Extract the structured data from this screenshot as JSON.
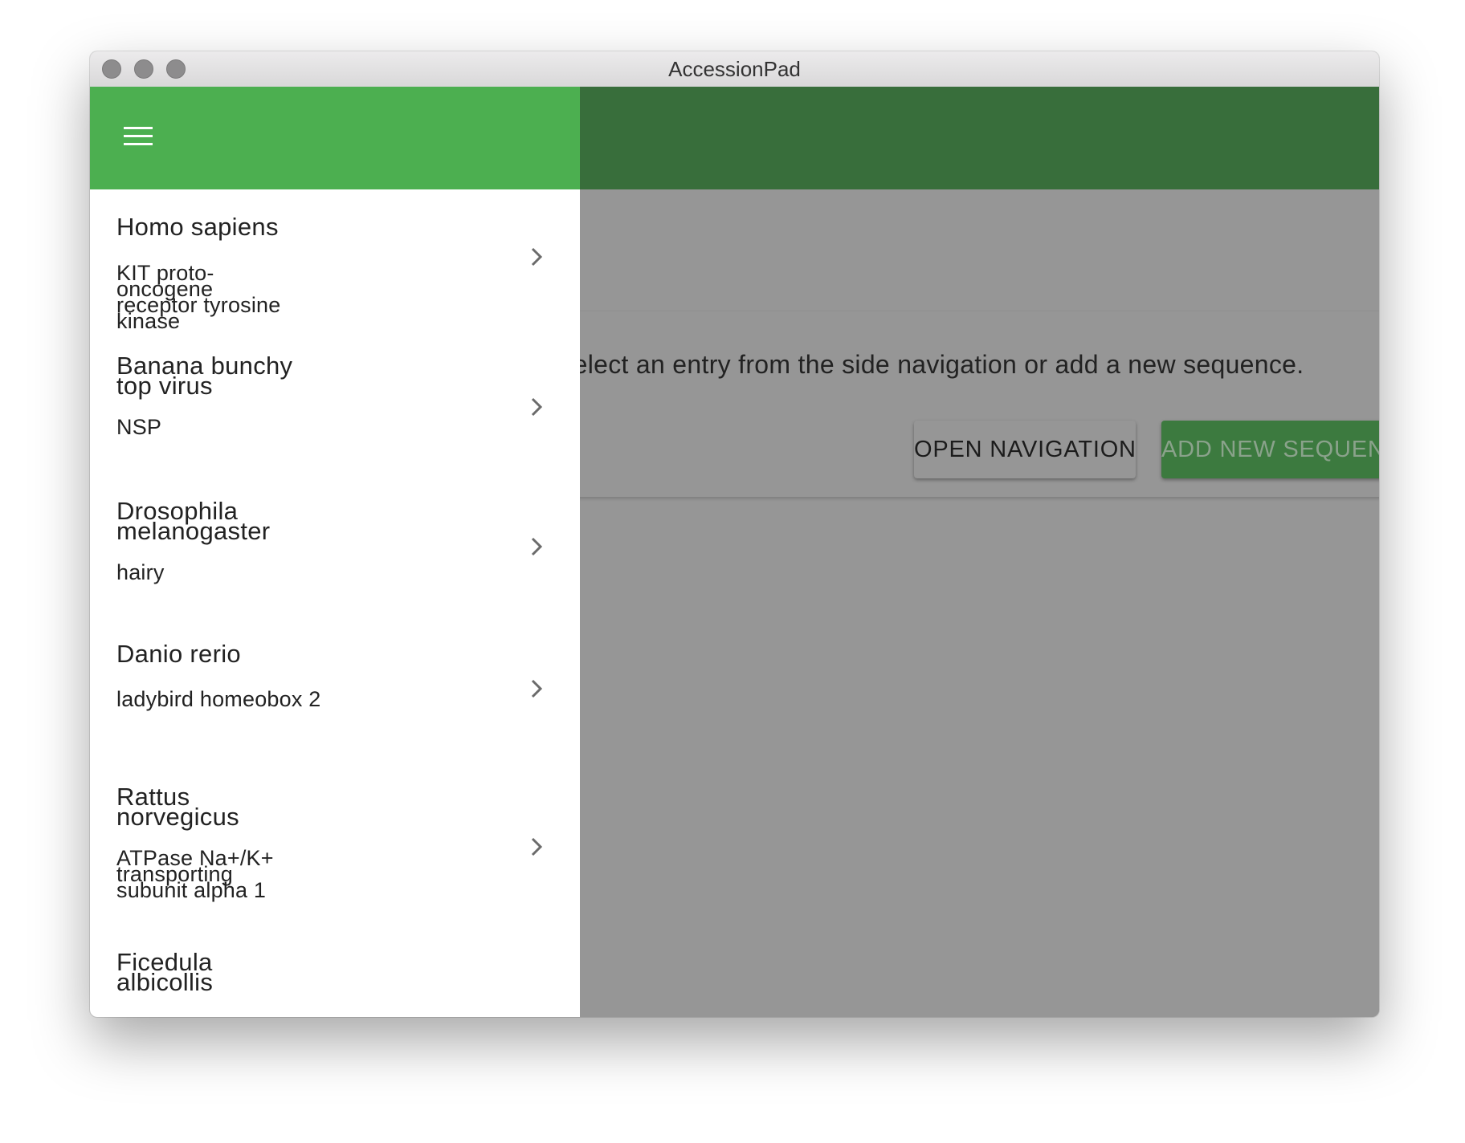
{
  "window": {
    "title": "AccessionPad"
  },
  "main": {
    "message": "Select an entry from the side navigation or add a new sequence.",
    "open_navigation_label": "OPEN NAVIGATION",
    "add_sequence_label": "ADD NEW SEQUENCE"
  },
  "drawer": {
    "menu_icon": "menu-icon",
    "items": [
      {
        "organism": "Homo sapiens",
        "gene": "KIT proto-oncogene receptor tyrosine kinase"
      },
      {
        "organism": "Banana bunchy top virus",
        "gene": "NSP"
      },
      {
        "organism": "Drosophila melanogaster",
        "gene": "hairy"
      },
      {
        "organism": "Danio rerio",
        "gene": "ladybird homeobox 2"
      },
      {
        "organism": "Rattus norvegicus",
        "gene": "ATPase Na+/K+ transporting subunit alpha 1"
      },
      {
        "organism": "Ficedula albicollis",
        "gene": ""
      }
    ]
  },
  "colors": {
    "drawer_header": "#4caf50",
    "appbar_scrimmed": "#386e3b",
    "scrim": "#969696",
    "add_button": "#3c7a3f"
  }
}
